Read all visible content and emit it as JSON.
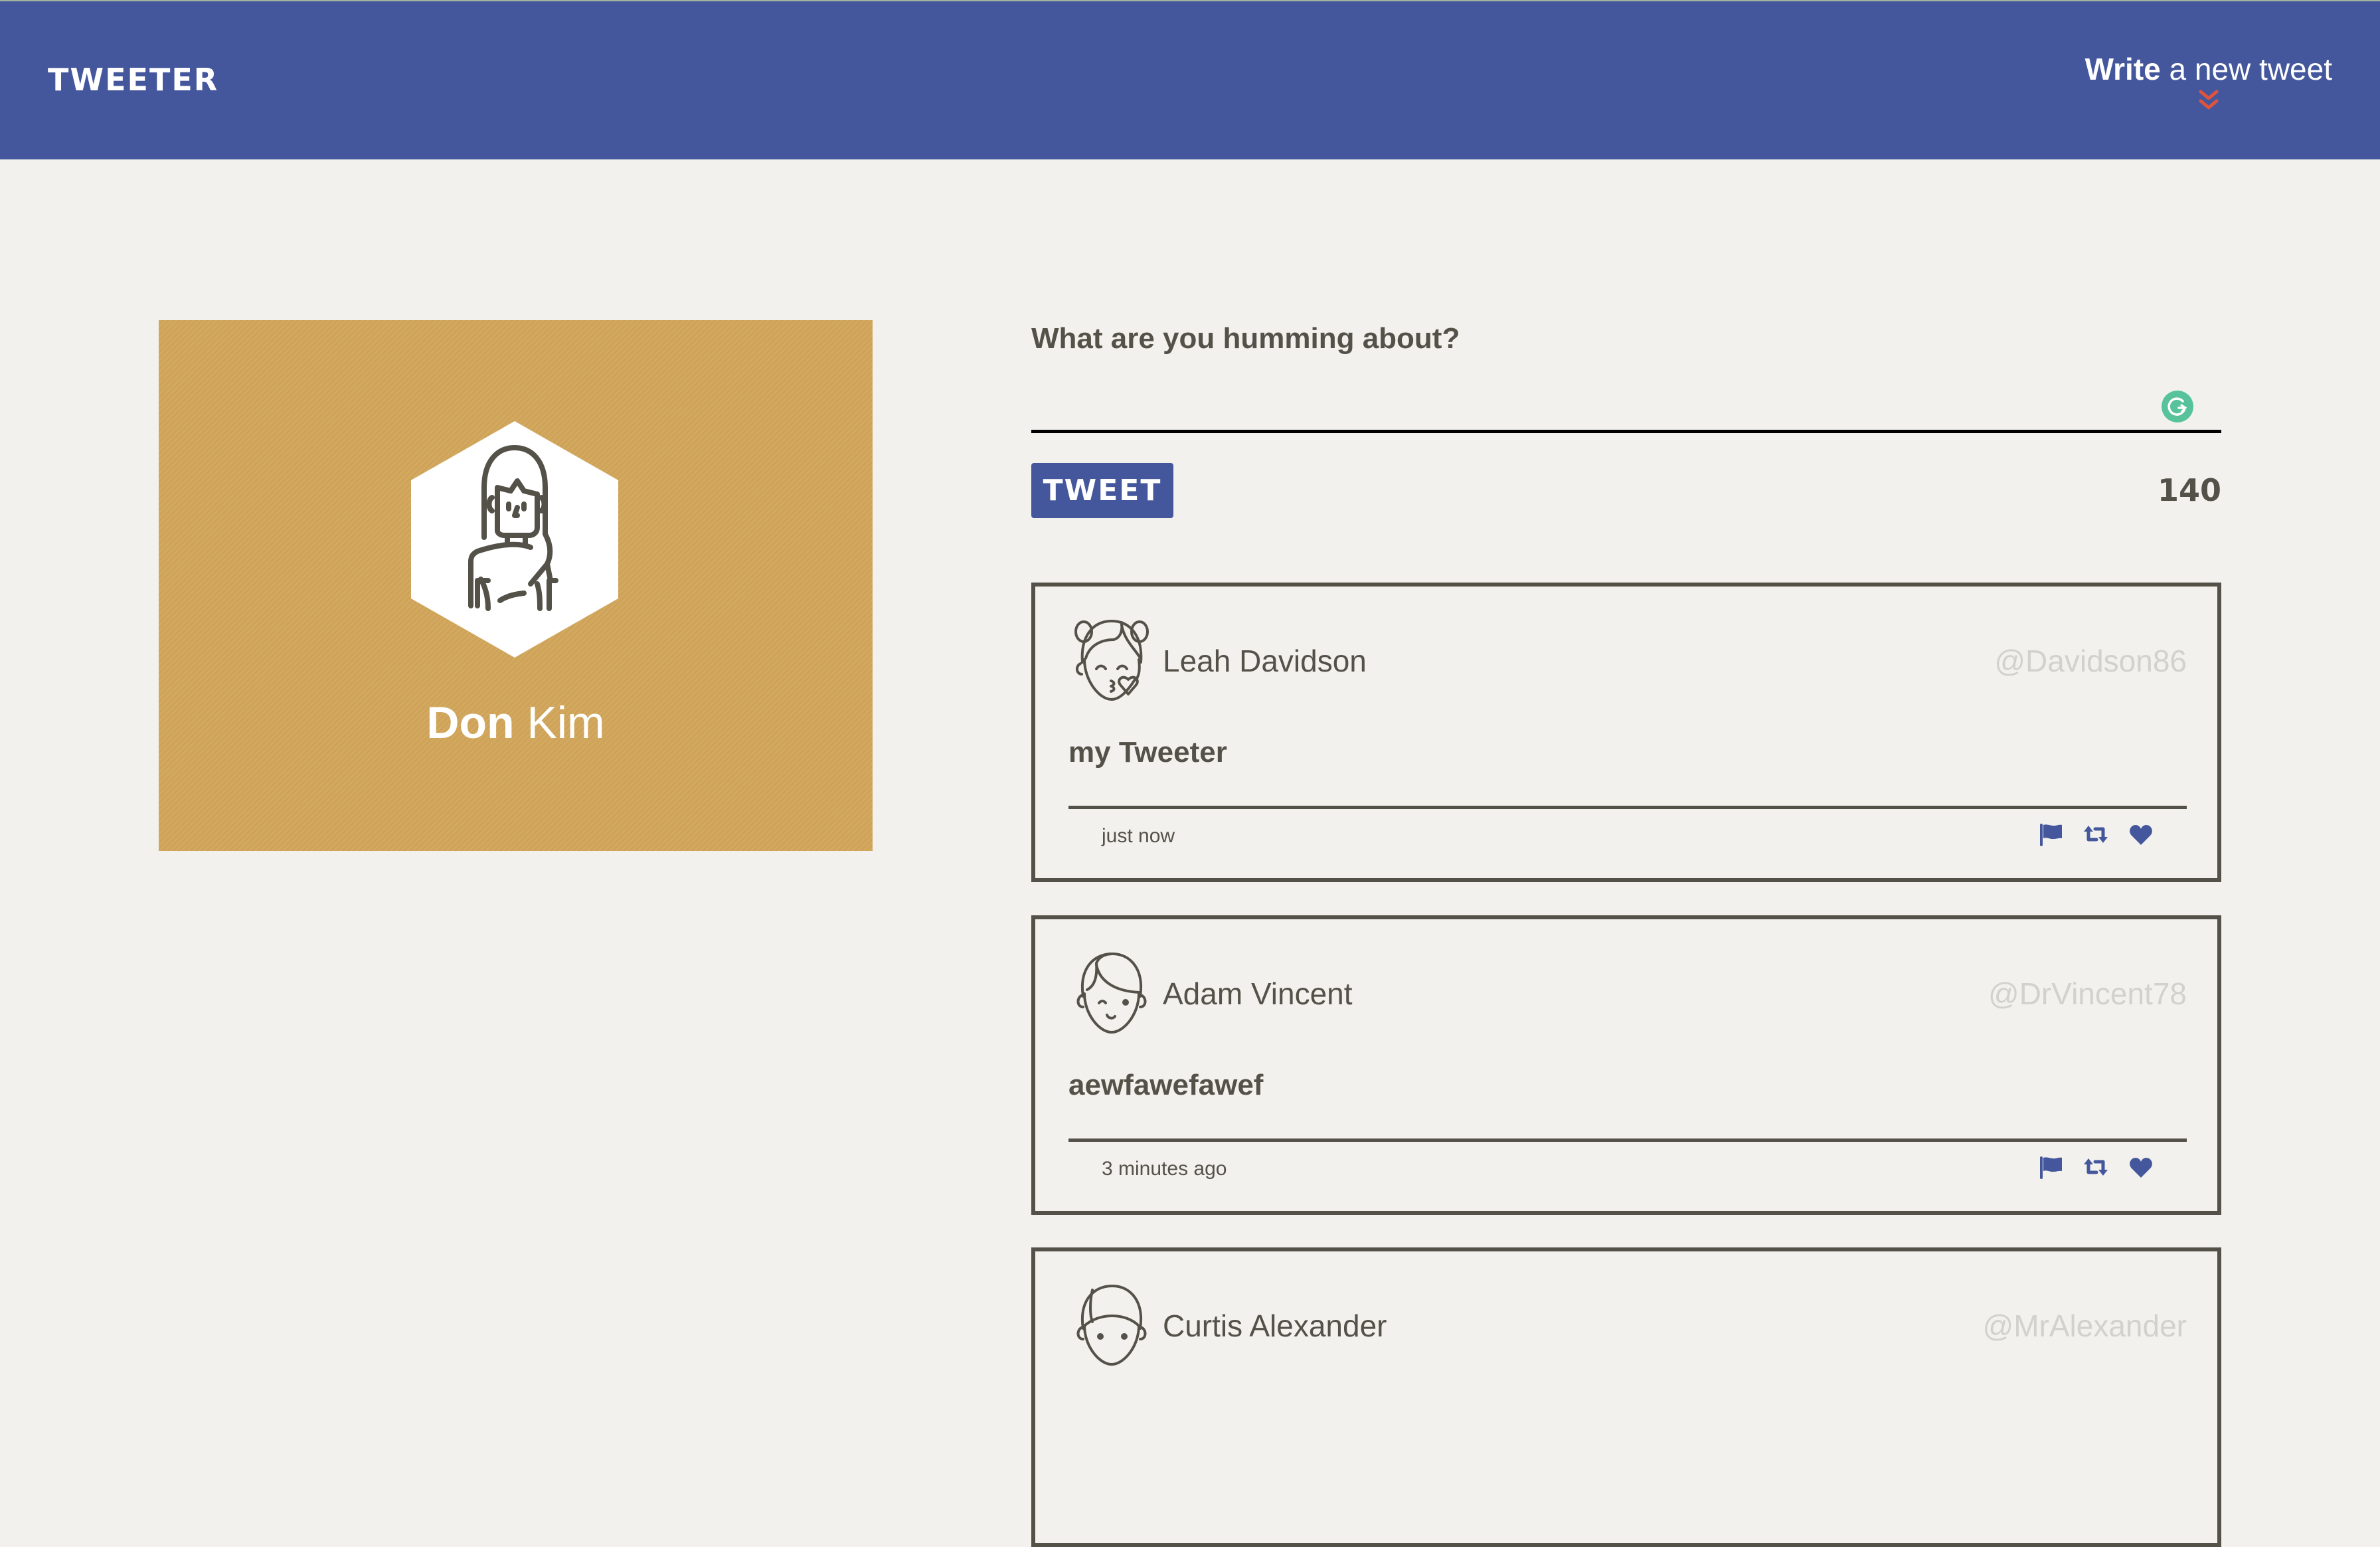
{
  "header": {
    "logo": "TWEETER",
    "compose_toggle": {
      "bold": "Write",
      "rest": "a new tweet",
      "icon": "double-chevron-down-icon"
    }
  },
  "colors": {
    "header_bg": "#44579c",
    "page_bg": "#f2f1ed",
    "profile_bg": "#d2a65b",
    "text": "#545149",
    "handle": "#d2d1cd",
    "accent": "#44579c",
    "chevron": "#e0533c",
    "grammarly": "#58c39b"
  },
  "profile": {
    "first_name": "Don",
    "last_name": "Kim",
    "avatar_icon": "woman-avatar-icon"
  },
  "compose": {
    "label": "What are you humming about?",
    "input_value": "",
    "input_placeholder": "",
    "button_label": "TWEET",
    "char_counter": "140"
  },
  "tweets": [
    {
      "name": "Leah Davidson",
      "handle": "@Davidson86",
      "content": "my Tweeter",
      "time": "just now",
      "avatar_icon": "girl-kiss-avatar-icon"
    },
    {
      "name": "Adam Vincent",
      "handle": "@DrVincent78",
      "content": "aewfawefawef",
      "time": "3 minutes ago",
      "avatar_icon": "boy-wink-avatar-icon"
    },
    {
      "name": "Curtis Alexander",
      "handle": "@MrAlexander",
      "content": "",
      "time": "",
      "avatar_icon": "boy-avatar-icon"
    }
  ],
  "tweet_actions": [
    "flag",
    "retweet",
    "like"
  ]
}
